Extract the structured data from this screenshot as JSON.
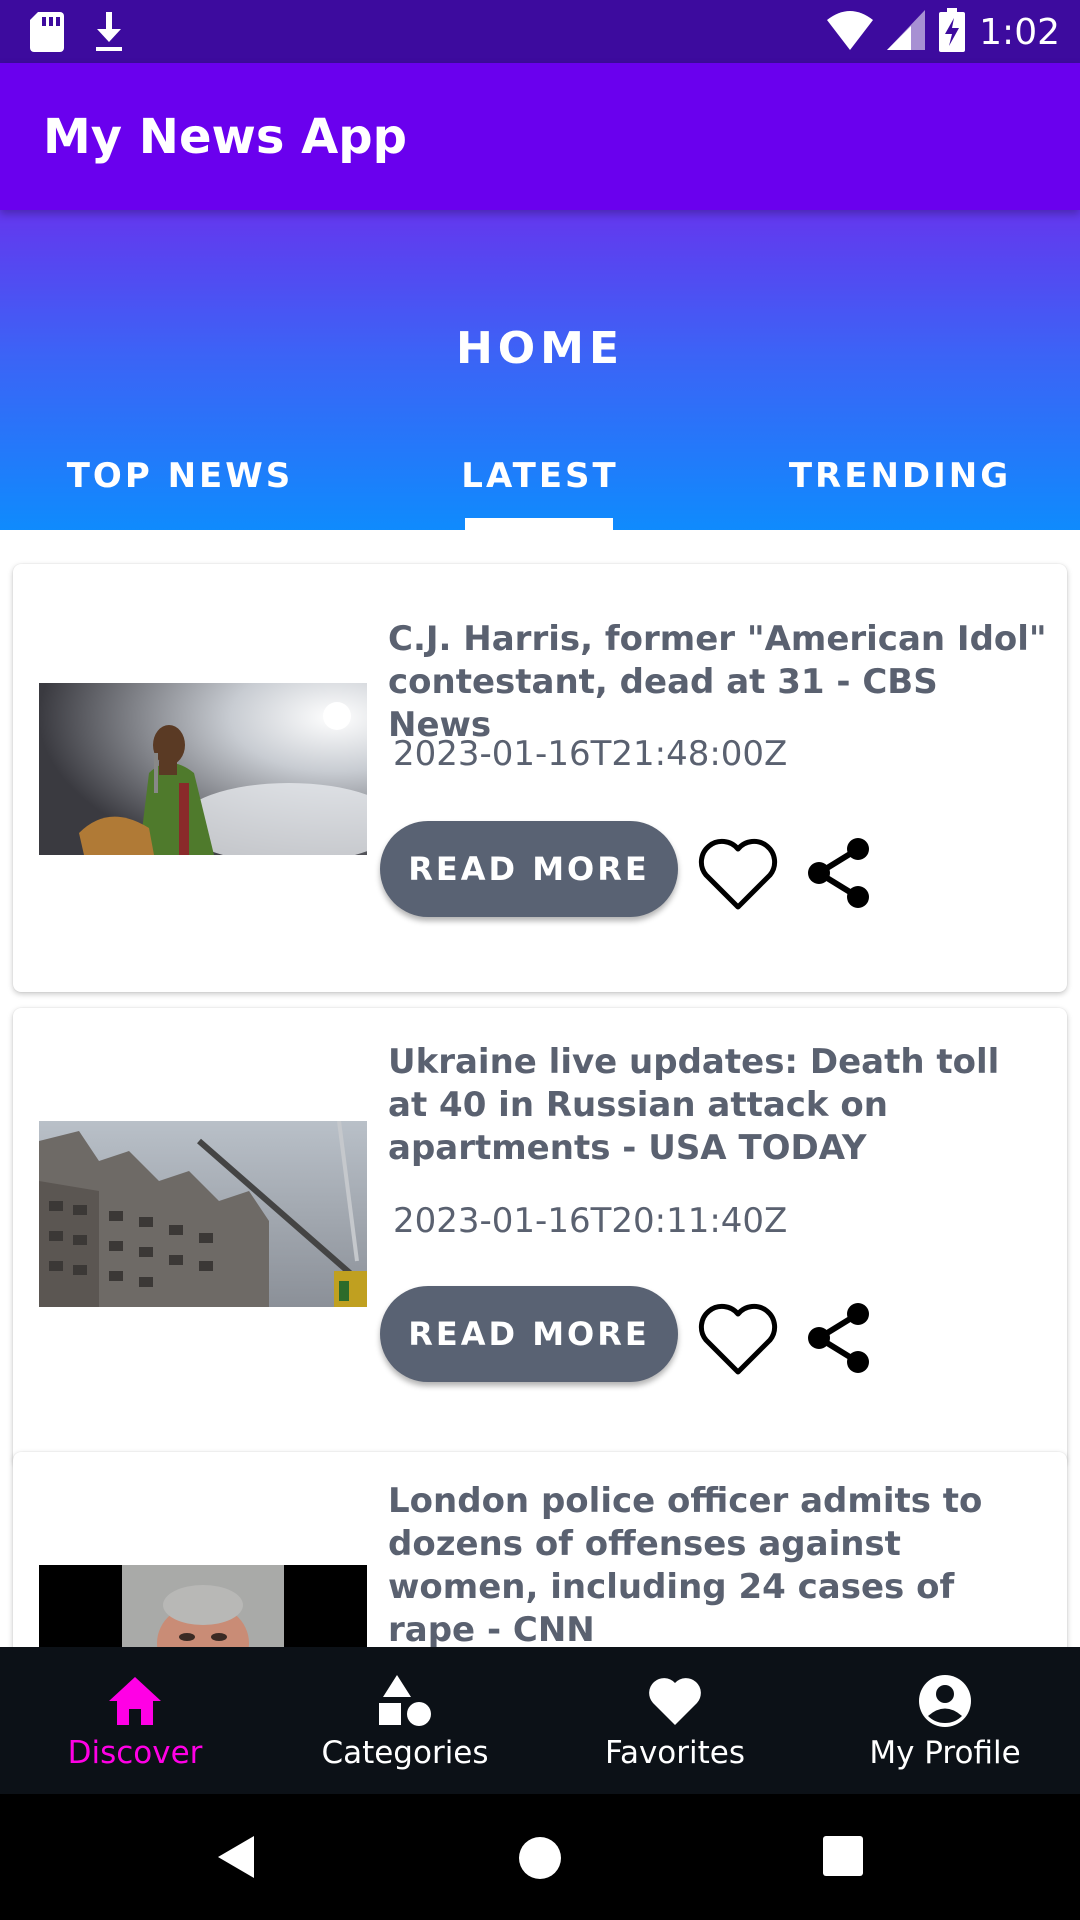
{
  "status_bar": {
    "time": "1:02"
  },
  "app_bar": {
    "title": "My News App"
  },
  "header": {
    "title": "HOME",
    "tabs": [
      {
        "label": "TOP NEWS",
        "active": false
      },
      {
        "label": "LATEST",
        "active": true
      },
      {
        "label": "TRENDING",
        "active": false
      }
    ]
  },
  "articles": [
    {
      "headline": "C.J. Harris, former \"American Idol\" contestant, dead at 31 - CBS News",
      "date": "2023-01-16T21:48:00Z",
      "read_more": "READ MORE"
    },
    {
      "headline": "Ukraine live updates: Death toll at 40 in Russian attack on apartments - USA TODAY",
      "date": "2023-01-16T20:11:40Z",
      "read_more": "READ MORE"
    },
    {
      "headline": "London police officer admits to dozens of offenses against women, including 24 cases of rape - CNN"
    }
  ],
  "bottom_nav": {
    "items": [
      {
        "label": "Discover",
        "icon": "home-icon",
        "active": true
      },
      {
        "label": "Categories",
        "icon": "categories-icon",
        "active": false
      },
      {
        "label": "Favorites",
        "icon": "heart-icon",
        "active": false
      },
      {
        "label": "My Profile",
        "icon": "account-circle-icon",
        "active": false
      }
    ]
  },
  "colors": {
    "status_bar": "#3d0b9e",
    "app_bar": "#6a00ee",
    "header_gradient_top": "#6437ee",
    "header_gradient_bottom": "#0f8bfd",
    "button": "#596273",
    "text_secondary": "#5a6170",
    "nav_background": "#0c1117",
    "nav_active": "#ff00e5"
  }
}
